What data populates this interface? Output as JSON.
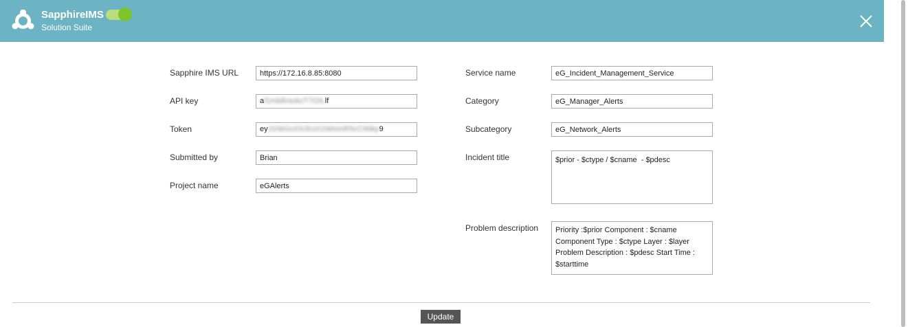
{
  "header": {
    "title": "SapphireIMS",
    "subtitle": "Solution Suite",
    "toggle_on": true,
    "background": "#6cb4c4",
    "toggle_color": "#7cc42a"
  },
  "left_form": {
    "url": {
      "label": "Sapphire IMS URL",
      "value": "https://172.16.8.85:8080"
    },
    "api_key": {
      "label": "API key",
      "prefix": "a",
      "masked": "f1mb8raukzT7I2IL",
      "suffix": "lf"
    },
    "token": {
      "label": "Token",
      "prefix": "ey",
      "masked": "J1hbGciOiJIUzI1NiIsInR5cCI6Ikp",
      "suffix": "9"
    },
    "submitted_by": {
      "label": "Submitted by",
      "value": "Brian"
    },
    "project_name": {
      "label": "Project name",
      "value": "eGAlerts"
    }
  },
  "right_form": {
    "service_name": {
      "label": "Service name",
      "value": "eG_Incident_Management_Service"
    },
    "category": {
      "label": "Category",
      "value": "eG_Manager_Alerts"
    },
    "subcategory": {
      "label": "Subcategory",
      "value": "eG_Network_Alerts"
    },
    "incident_title": {
      "label": "Incident title",
      "value": "$prior - $ctype / $cname  - $pdesc"
    },
    "problem_description": {
      "label": "Problem description",
      "value": "Priority :$prior Component : $cname Component Type : $ctype Layer : $layer Problem Description : $pdesc Start Time : $starttime"
    }
  },
  "footer": {
    "update_label": "Update"
  }
}
